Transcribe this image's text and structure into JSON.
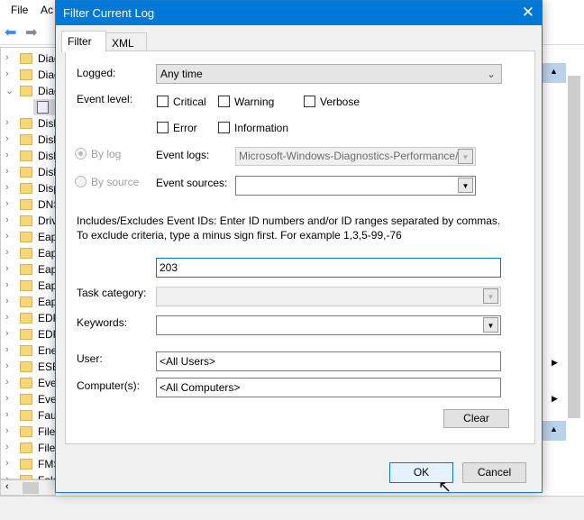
{
  "app": {
    "menu": [
      "File",
      "Ac"
    ]
  },
  "tree": {
    "items": [
      {
        "label": "Diag",
        "expanded": false
      },
      {
        "label": "Diag",
        "expanded": false
      },
      {
        "label": "Diag",
        "expanded": true
      },
      {
        "label": "",
        "log": true
      },
      {
        "label": "Disk"
      },
      {
        "label": "Disk"
      },
      {
        "label": "Disk"
      },
      {
        "label": "Disk"
      },
      {
        "label": "Disp"
      },
      {
        "label": "DNS"
      },
      {
        "label": "Driv"
      },
      {
        "label": "Eap"
      },
      {
        "label": "Eap"
      },
      {
        "label": "Eap"
      },
      {
        "label": "Eap"
      },
      {
        "label": "Eap"
      },
      {
        "label": "EDP"
      },
      {
        "label": "EDP"
      },
      {
        "label": "Ene"
      },
      {
        "label": "ESE"
      },
      {
        "label": "Eve"
      },
      {
        "label": "Eve"
      },
      {
        "label": "Fau"
      },
      {
        "label": "File"
      },
      {
        "label": "File"
      },
      {
        "label": "FMS"
      },
      {
        "label": "Fold"
      }
    ]
  },
  "dialog": {
    "title": "Filter Current Log",
    "tabs": [
      "Filter",
      "XML"
    ],
    "logged_label": "Logged:",
    "logged_value": "Any time",
    "event_level_label": "Event level:",
    "levels": {
      "critical": "Critical",
      "warning": "Warning",
      "verbose": "Verbose",
      "error": "Error",
      "information": "Information"
    },
    "by_log": "By log",
    "by_source": "By source",
    "event_logs_label": "Event logs:",
    "event_logs_value": "Microsoft-Windows-Diagnostics-Performance/",
    "event_sources_label": "Event sources:",
    "event_sources_value": "",
    "ids_help": "Includes/Excludes Event IDs: Enter ID numbers and/or ID ranges separated by commas. To exclude criteria, type a minus sign first. For example 1,3,5-99,-76",
    "ids_value": "203",
    "task_category_label": "Task category:",
    "task_category_value": "",
    "keywords_label": "Keywords:",
    "keywords_value": "",
    "user_label": "User:",
    "user_value": "<All Users>",
    "computer_label": "Computer(s):",
    "computer_value": "<All Computers>",
    "clear": "Clear",
    "ok": "OK",
    "cancel": "Cancel"
  }
}
